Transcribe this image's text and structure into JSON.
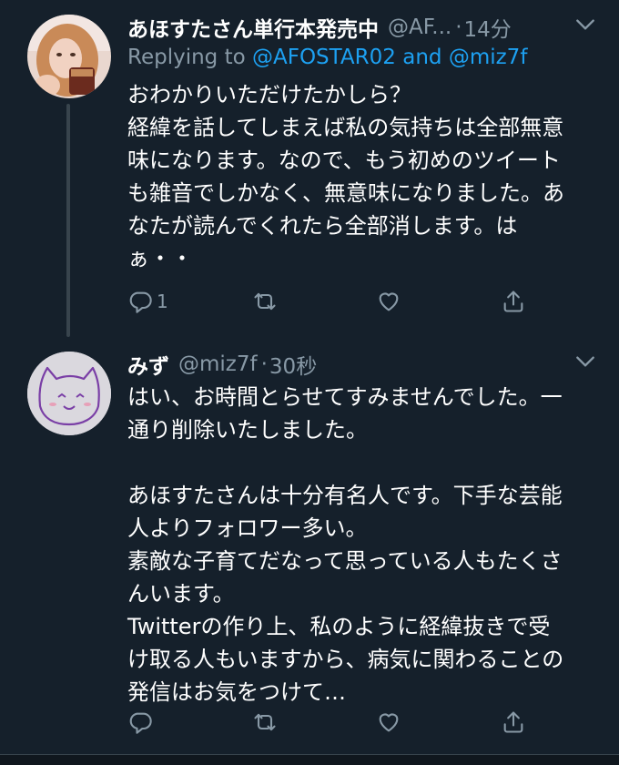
{
  "tweets": [
    {
      "name": "あほすたさん単行本発売中",
      "handle": "@AF...",
      "dot": "·",
      "time": "14分",
      "replying_prefix": "Replying to",
      "mention_1": "@AFOSTAR02",
      "and": "and",
      "mention_2": "@miz7f",
      "text": "おわかりいただけたかしら？\n経緯を話してしまえば私の気持ちは全部無意\n味になります。なので、もう初めのツイート\nも雑音でしかなく、無意味になりました。あ\nなたが読んでくれたら全部消します。は\nぁ・・",
      "reply_count": "1",
      "retweet_count": "",
      "like_count": ""
    },
    {
      "name": "みず",
      "handle": "@miz7f",
      "dot": "·",
      "time": "30秒",
      "text": "はい、お時間とらせてすみませんでした。一\n通り削除いたしました。\n\nあほすたさんは十分有名人です。下手な芸能\n人よりフォロワー多い。\n素敵な子育てだなって思っている人もたくさ\nんいます。\nTwitterの作り上、私のように経緯抜きで受\nけ取る人もいますから、病気に関わることの\n発信はお気をつけて…",
      "reply_count": "",
      "retweet_count": "",
      "like_count": ""
    }
  ],
  "icons": {
    "reply": "reply-icon",
    "retweet": "retweet-icon",
    "like": "heart-icon",
    "share": "share-icon",
    "caret": "chevron-down-icon"
  },
  "colors": {
    "background": "#15202b",
    "secondary_text": "#8899a6",
    "link": "#1da1f2",
    "thread_line": "#38444d"
  }
}
